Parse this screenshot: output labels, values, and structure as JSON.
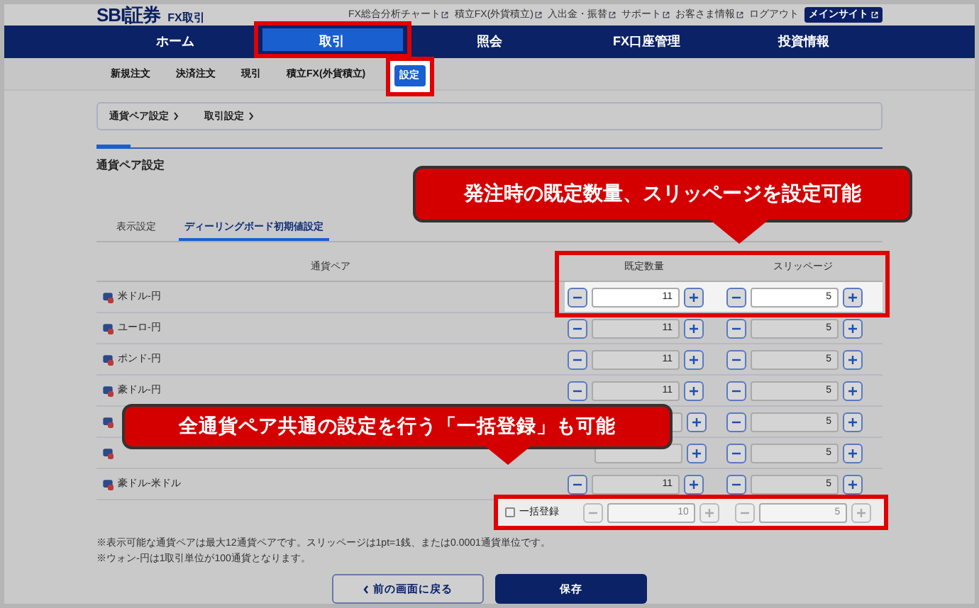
{
  "header": {
    "logo": "SBI証券",
    "product": "FX取引",
    "links": [
      {
        "label": "FX総合分析チャート",
        "external": true
      },
      {
        "label": "積立FX(外貨積立)",
        "external": true
      },
      {
        "label": "入出金・振替",
        "external": true
      },
      {
        "label": "サポート",
        "external": true
      },
      {
        "label": "お客さま情報",
        "external": true
      },
      {
        "label": "ログアウト",
        "external": false
      }
    ],
    "main_site": "メインサイト"
  },
  "nav": [
    {
      "label": "ホーム",
      "selected": false
    },
    {
      "label": "取引",
      "selected": true
    },
    {
      "label": "照会",
      "selected": false
    },
    {
      "label": "FX口座管理",
      "selected": false
    },
    {
      "label": "投資情報",
      "selected": false
    }
  ],
  "subnav": [
    {
      "label": "新規注文",
      "selected": false
    },
    {
      "label": "決済注文",
      "selected": false
    },
    {
      "label": "現引",
      "selected": false
    },
    {
      "label": "積立FX(外貨積立)",
      "selected": false
    },
    {
      "label": "設定",
      "selected": true
    }
  ],
  "breadcrumb": [
    "通貨ペア設定",
    "取引設定"
  ],
  "heading": "通貨ペア設定",
  "tabs": [
    {
      "label": "表示設定",
      "selected": false
    },
    {
      "label": "ディーリングボード初期値設定",
      "selected": true
    }
  ],
  "table": {
    "columns": [
      "通貨ペア",
      "既定数量",
      "スリッページ"
    ],
    "rows": [
      {
        "name": "米ドル-円",
        "qty": "11",
        "slip": "5",
        "highlighted": true
      },
      {
        "name": "ユーロ-円",
        "qty": "11",
        "slip": "5",
        "highlighted": false
      },
      {
        "name": "ポンド-円",
        "qty": "11",
        "slip": "5",
        "highlighted": false
      },
      {
        "name": "豪ドル-円",
        "qty": "11",
        "slip": "5",
        "highlighted": false
      },
      {
        "slip": "5",
        "highlighted": false
      },
      {
        "slip": "5",
        "highlighted": false
      },
      {
        "name": "豪ドル-米ドル",
        "qty": "11",
        "slip": "5",
        "highlighted": false
      }
    ],
    "bulk": {
      "label": "一括登録",
      "checked": false,
      "qty": "10",
      "slip": "5"
    }
  },
  "notes": [
    "※表示可能な通貨ペアは最大12通貨ペアです。スリッページは1pt=1銭、または0.0001通貨単位です。",
    "※ウォン-円は1取引単位が100通貨となります。"
  ],
  "buttons": {
    "back": "前の画面に戻る",
    "save": "保存"
  },
  "callouts": [
    "発注時の既定数量、スリッページを設定可能",
    "全通貨ペア共通の設定を行う「一括登録」も可能"
  ]
}
